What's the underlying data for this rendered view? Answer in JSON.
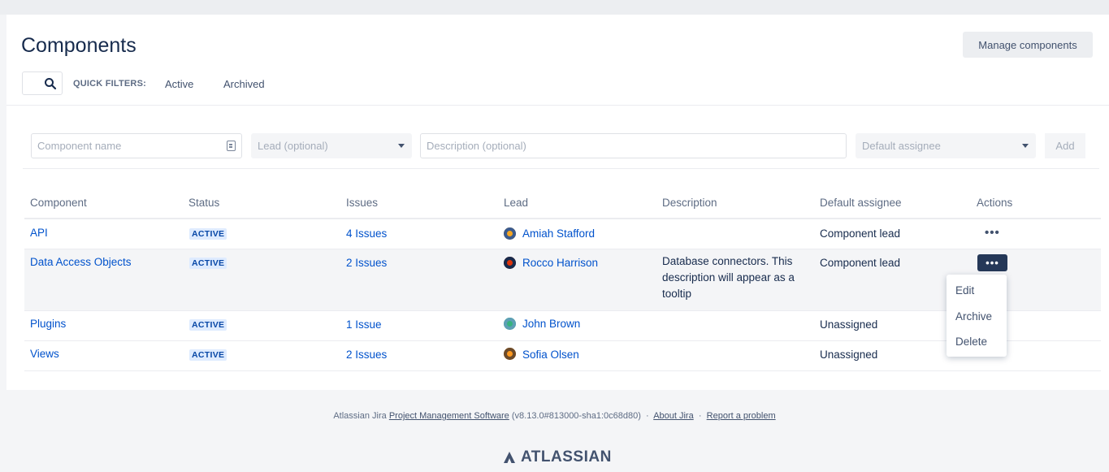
{
  "header": {
    "title": "Components",
    "manage_label": "Manage components"
  },
  "filters": {
    "search_placeholder": "",
    "quick_filters_label": "QUICK FILTERS:",
    "active_label": "Active",
    "archived_label": "Archived"
  },
  "form": {
    "name_placeholder": "Component name",
    "lead_placeholder": "Lead (optional)",
    "description_placeholder": "Description (optional)",
    "assignee_placeholder": "Default assignee",
    "add_label": "Add"
  },
  "table": {
    "columns": [
      "Component",
      "Status",
      "Issues",
      "Lead",
      "Description",
      "Default assignee",
      "Actions"
    ],
    "rows": [
      {
        "component": "API",
        "status": "ACTIVE",
        "issues": "4 Issues",
        "lead": "Amiah Stafford",
        "description": "",
        "assignee": "Component lead",
        "actions": "•••"
      },
      {
        "component": "Data Access Objects",
        "status": "ACTIVE",
        "issues": "2 Issues",
        "lead": "Rocco Harrison",
        "description": "Database connectors. This description will appear as a tooltip",
        "assignee": "Component lead",
        "actions": "•••"
      },
      {
        "component": "Plugins",
        "status": "ACTIVE",
        "issues": "1 Issue",
        "lead": "John Brown",
        "description": "",
        "assignee": "Unassigned",
        "actions": "•••"
      },
      {
        "component": "Views",
        "status": "ACTIVE",
        "issues": "2 Issues",
        "lead": "Sofia Olsen",
        "description": "",
        "assignee": "Unassigned",
        "actions": "•••"
      }
    ]
  },
  "actions_menu": {
    "items": [
      "Edit",
      "Archive",
      "Delete"
    ]
  },
  "footer": {
    "prefix": "Atlassian Jira",
    "software_link": "Project Management Software",
    "version": "(v8.13.0#813000-sha1:0c68d80)",
    "about_link": "About Jira",
    "report_link": "Report a problem",
    "sep": "·",
    "logo_text": "ATLASSIAN"
  },
  "colors": {
    "accent": "#0052cc",
    "lozenge_bg": "#deebff",
    "avatar_amiah": "#f5a623",
    "avatar_rocco": "#de350b",
    "avatar_john": "#36b37e",
    "avatar_sofia": "#ff991f"
  }
}
